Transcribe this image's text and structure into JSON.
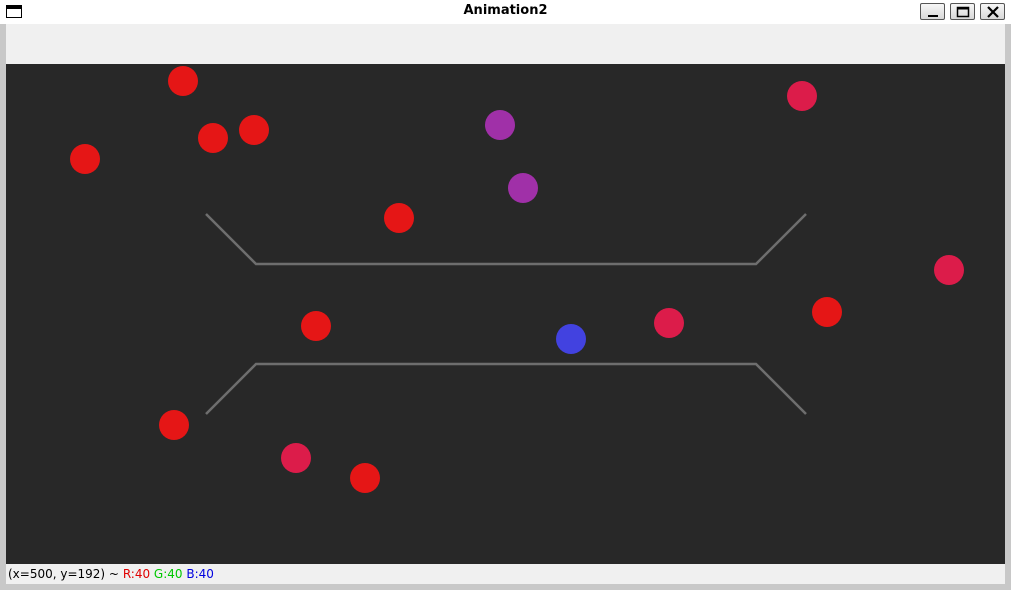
{
  "window": {
    "title": "Animation2"
  },
  "status": {
    "position_text": "(x=500, y=192) ~",
    "r_text": "R:40",
    "g_text": "G:40",
    "b_text": "B:40"
  },
  "colors": {
    "canvas_background": "#282828",
    "guide_line": "#6e6e6e",
    "ball_red": "#e51616",
    "ball_crimson": "#dc1c4a",
    "ball_purple": "#a030a8",
    "ball_blue": "#4242e0"
  },
  "scene": {
    "balls": [
      {
        "color": "ball_red"
      },
      {
        "color": "ball_red"
      },
      {
        "color": "ball_red"
      },
      {
        "color": "ball_red"
      },
      {
        "color": "ball_purple"
      },
      {
        "color": "ball_purple"
      },
      {
        "color": "ball_red"
      },
      {
        "color": "ball_crimson"
      },
      {
        "color": "ball_crimson"
      },
      {
        "color": "ball_red"
      },
      {
        "color": "ball_red"
      },
      {
        "color": "ball_blue"
      },
      {
        "color": "ball_crimson"
      },
      {
        "color": "ball_red"
      },
      {
        "color": "ball_crimson"
      },
      {
        "color": "ball_red"
      }
    ]
  }
}
